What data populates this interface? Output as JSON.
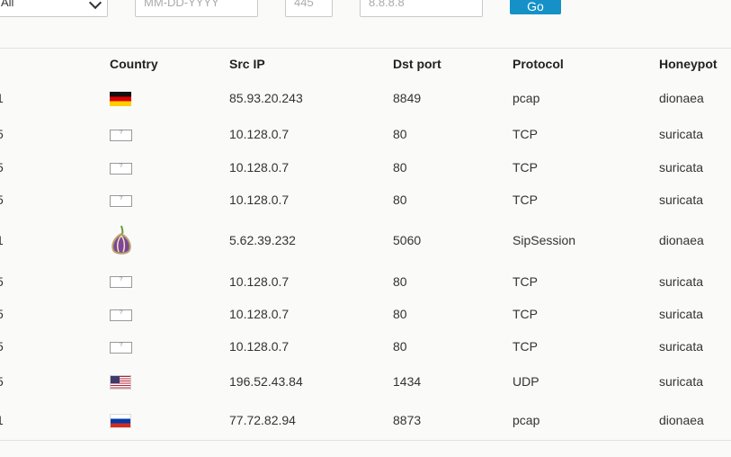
{
  "filters": {
    "select_value": "All",
    "date_placeholder": "MM-DD-YYYY",
    "port_placeholder": "445",
    "ip_placeholder": "8.8.8.8",
    "go_label": "Go"
  },
  "table": {
    "headers": [
      "Country",
      "Src IP",
      "Dst port",
      "Protocol",
      "Honeypot"
    ],
    "rows": [
      {
        "lead": "1",
        "flag": "germany-flag",
        "src_ip": "85.93.20.243",
        "dst_port": "8849",
        "protocol": "pcap",
        "honeypot": "dionaea"
      },
      {
        "lead": "5",
        "flag": "unknown-flag",
        "src_ip": "10.128.0.7",
        "dst_port": "80",
        "protocol": "TCP",
        "honeypot": "suricata"
      },
      {
        "lead": "5",
        "flag": "unknown-flag",
        "src_ip": "10.128.0.7",
        "dst_port": "80",
        "protocol": "TCP",
        "honeypot": "suricata"
      },
      {
        "lead": "5",
        "flag": "unknown-flag",
        "src_ip": "10.128.0.7",
        "dst_port": "80",
        "protocol": "TCP",
        "honeypot": "suricata"
      },
      {
        "lead": "1",
        "flag": "tor-onion-icon",
        "src_ip": "5.62.39.232",
        "dst_port": "5060",
        "protocol": "SipSession",
        "honeypot": "dionaea"
      },
      {
        "lead": "5",
        "flag": "unknown-flag",
        "src_ip": "10.128.0.7",
        "dst_port": "80",
        "protocol": "TCP",
        "honeypot": "suricata"
      },
      {
        "lead": "5",
        "flag": "unknown-flag",
        "src_ip": "10.128.0.7",
        "dst_port": "80",
        "protocol": "TCP",
        "honeypot": "suricata"
      },
      {
        "lead": "5",
        "flag": "unknown-flag",
        "src_ip": "10.128.0.7",
        "dst_port": "80",
        "protocol": "TCP",
        "honeypot": "suricata"
      },
      {
        "lead": "5",
        "flag": "usa-flag",
        "src_ip": "196.52.43.84",
        "dst_port": "1434",
        "protocol": "UDP",
        "honeypot": "suricata"
      },
      {
        "lead": "1",
        "flag": "russia-flag",
        "src_ip": "77.72.82.94",
        "dst_port": "8873",
        "protocol": "pcap",
        "honeypot": "dionaea"
      }
    ]
  }
}
